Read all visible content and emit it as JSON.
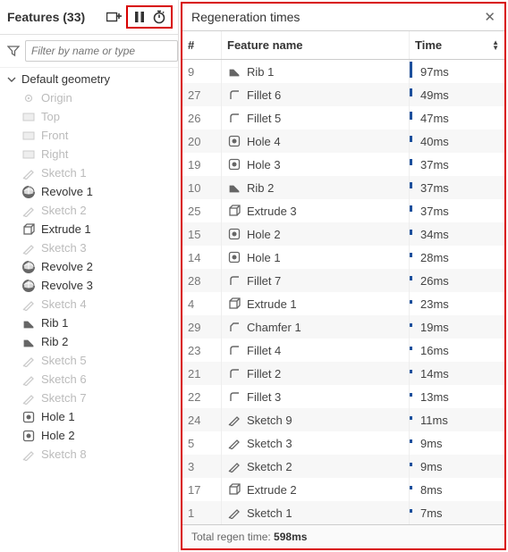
{
  "left": {
    "title": "Features (33)",
    "filter_placeholder": "Filter by name or type",
    "root_label": "Default geometry",
    "geom_children": [
      {
        "label": "Origin",
        "icon": "origin"
      },
      {
        "label": "Top",
        "icon": "plane"
      },
      {
        "label": "Front",
        "icon": "plane"
      },
      {
        "label": "Right",
        "icon": "plane"
      }
    ],
    "features": [
      {
        "label": "Sketch 1",
        "icon": "sketch",
        "muted": true
      },
      {
        "label": "Revolve 1",
        "icon": "revolve",
        "muted": false
      },
      {
        "label": "Sketch 2",
        "icon": "sketch",
        "muted": true
      },
      {
        "label": "Extrude 1",
        "icon": "extrude",
        "muted": false
      },
      {
        "label": "Sketch 3",
        "icon": "sketch",
        "muted": true
      },
      {
        "label": "Revolve 2",
        "icon": "revolve",
        "muted": false
      },
      {
        "label": "Revolve 3",
        "icon": "revolve",
        "muted": false
      },
      {
        "label": "Sketch 4",
        "icon": "sketch",
        "muted": true
      },
      {
        "label": "Rib 1",
        "icon": "rib",
        "muted": false
      },
      {
        "label": "Rib 2",
        "icon": "rib",
        "muted": false
      },
      {
        "label": "Sketch 5",
        "icon": "sketch",
        "muted": true
      },
      {
        "label": "Sketch 6",
        "icon": "sketch",
        "muted": true
      },
      {
        "label": "Sketch 7",
        "icon": "sketch",
        "muted": true
      },
      {
        "label": "Hole 1",
        "icon": "hole",
        "muted": false
      },
      {
        "label": "Hole 2",
        "icon": "hole",
        "muted": false
      },
      {
        "label": "Sketch 8",
        "icon": "sketch",
        "muted": true
      }
    ]
  },
  "right": {
    "title": "Regeneration times",
    "col_num": "#",
    "col_name": "Feature name",
    "col_time": "Time",
    "footer_label": "Total regen time: ",
    "footer_value": "598ms",
    "rows": [
      {
        "n": "9",
        "name": "Rib 1",
        "icon": "rib",
        "time": "97ms",
        "bar": 97
      },
      {
        "n": "27",
        "name": "Fillet 6",
        "icon": "fillet",
        "time": "49ms",
        "bar": 49
      },
      {
        "n": "26",
        "name": "Fillet 5",
        "icon": "fillet",
        "time": "47ms",
        "bar": 47
      },
      {
        "n": "20",
        "name": "Hole 4",
        "icon": "hole",
        "time": "40ms",
        "bar": 40
      },
      {
        "n": "19",
        "name": "Hole 3",
        "icon": "hole",
        "time": "37ms",
        "bar": 37
      },
      {
        "n": "10",
        "name": "Rib 2",
        "icon": "rib",
        "time": "37ms",
        "bar": 37
      },
      {
        "n": "25",
        "name": "Extrude 3",
        "icon": "extrude",
        "time": "37ms",
        "bar": 37
      },
      {
        "n": "15",
        "name": "Hole 2",
        "icon": "hole",
        "time": "34ms",
        "bar": 34
      },
      {
        "n": "14",
        "name": "Hole 1",
        "icon": "hole",
        "time": "28ms",
        "bar": 28
      },
      {
        "n": "28",
        "name": "Fillet 7",
        "icon": "fillet",
        "time": "26ms",
        "bar": 26
      },
      {
        "n": "4",
        "name": "Extrude 1",
        "icon": "extrude",
        "time": "23ms",
        "bar": 23
      },
      {
        "n": "29",
        "name": "Chamfer 1",
        "icon": "chamfer",
        "time": "19ms",
        "bar": 19
      },
      {
        "n": "23",
        "name": "Fillet 4",
        "icon": "fillet",
        "time": "16ms",
        "bar": 16
      },
      {
        "n": "21",
        "name": "Fillet 2",
        "icon": "fillet",
        "time": "14ms",
        "bar": 14
      },
      {
        "n": "22",
        "name": "Fillet 3",
        "icon": "fillet",
        "time": "13ms",
        "bar": 13
      },
      {
        "n": "24",
        "name": "Sketch 9",
        "icon": "sketch",
        "time": "11ms",
        "bar": 11
      },
      {
        "n": "5",
        "name": "Sketch 3",
        "icon": "sketch",
        "time": "9ms",
        "bar": 9
      },
      {
        "n": "3",
        "name": "Sketch 2",
        "icon": "sketch",
        "time": "9ms",
        "bar": 9
      },
      {
        "n": "17",
        "name": "Extrude 2",
        "icon": "extrude",
        "time": "8ms",
        "bar": 8
      },
      {
        "n": "1",
        "name": "Sketch 1",
        "icon": "sketch",
        "time": "7ms",
        "bar": 7
      }
    ]
  }
}
